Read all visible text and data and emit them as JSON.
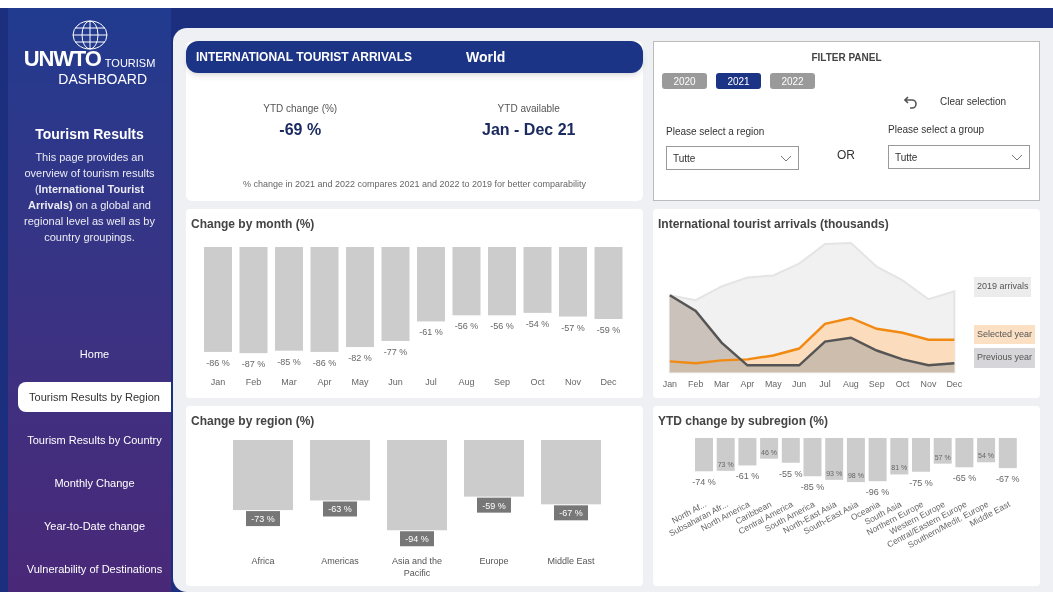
{
  "sidebar": {
    "logo_text": "UNWTO",
    "logo_sub1": "TOURISM",
    "logo_sub2": "DASHBOARD",
    "title": "Tourism Results",
    "description": "This page provides an overview of tourism results (**International Tourist Arrivals)** on a global and regional level as well as by country groupings.",
    "nav": [
      {
        "label": "Home",
        "selected": false
      },
      {
        "label": "Tourism Results by Region",
        "selected": true
      },
      {
        "label": "Tourism Results by Country",
        "selected": false
      },
      {
        "label": "Monthly Change",
        "selected": false
      },
      {
        "label": "Year-to-Date change",
        "selected": false
      },
      {
        "label": "Vulnerability of Destinations",
        "selected": false
      }
    ]
  },
  "summary": {
    "header": "INTERNATIONAL TOURIST ARRIVALS",
    "area": "World",
    "kpis": [
      {
        "label": "YTD change (%)",
        "value": "-69 %"
      },
      {
        "label": "YTD available",
        "value": "Jan - Dec 21"
      }
    ],
    "note": "% change in 2021 and 2022 compares 2021 and 2022  to 2019 for better comparability"
  },
  "filter_panel": {
    "title": "FILTER PANEL",
    "years": [
      {
        "label": "2020",
        "selected": false
      },
      {
        "label": "2021",
        "selected": true
      },
      {
        "label": "2022",
        "selected": false
      }
    ],
    "clear": "Clear selection",
    "region_label": "Please select a region",
    "region_value": "Tutte",
    "or": "OR",
    "group_label": "Please select a group",
    "group_value": "Tutte"
  },
  "month_chart": {
    "chart_data": {
      "type": "bar",
      "title": "Change by month (%)",
      "categories": [
        "Jan",
        "Feb",
        "Mar",
        "Apr",
        "May",
        "Jun",
        "Jul",
        "Aug",
        "Sep",
        "Oct",
        "Nov",
        "Dec"
      ],
      "values": [
        -86,
        -87,
        -85,
        -86,
        -82,
        -77,
        -61,
        -56,
        -56,
        -54,
        -57,
        -59
      ],
      "value_labels": [
        "-86 %",
        "-87 %",
        "-85 %",
        "-86 %",
        "-82 %",
        "-77 %",
        "-61 %",
        "-56 %",
        "-56 %",
        "-54 %",
        "-57 %",
        "-59 %"
      ]
    }
  },
  "arrivals_chart": {
    "title": "International tourist arrivals (thousands)",
    "x_labels": [
      "Jan",
      "Feb",
      "Mar",
      "Apr",
      "May",
      "Jun",
      "Jul",
      "Aug",
      "Sep",
      "Oct",
      "Nov",
      "Dec"
    ],
    "legend": [
      {
        "label": "2019 arrivals",
        "color": "#ececec"
      },
      {
        "label": "Selected year",
        "color": "#fbe0c4"
      },
      {
        "label": "Previous year",
        "color": "#d6d6da"
      }
    ]
  },
  "region_chart": {
    "chart_data": {
      "type": "bar",
      "title": "Change by region (%)",
      "categories": [
        "Africa",
        "Americas",
        "Asia and the Pacific",
        "Europe",
        "Middle East"
      ],
      "values": [
        -73,
        -63,
        -94,
        -59,
        -67
      ],
      "value_labels": [
        "-73 %",
        "-63 %",
        "-94 %",
        "-59 %",
        "-67 %"
      ]
    }
  },
  "subregion_chart": {
    "chart_data": {
      "type": "bar",
      "title": "YTD change by subregion (%)",
      "categories": [
        "North Af...",
        "Subsaharan Afr...",
        "North America",
        "Caribbean",
        "Central America",
        "South America",
        "North-East Asia",
        "South-East Asia",
        "Oceania",
        "South Asia",
        "Northern Europe",
        "Western Europe",
        "Central/Eastern Europe",
        "Southern/Medit. Europe",
        "Middle East"
      ],
      "values": [
        -74,
        -73,
        -61,
        -46,
        -55,
        -85,
        -93,
        -98,
        -96,
        -81,
        -75,
        -57,
        -65,
        -54,
        -67
      ],
      "value_labels": [
        "-74 %",
        null,
        "-61 %",
        null,
        "-55 %",
        "-85 %",
        null,
        null,
        "-96 %",
        null,
        "-75 %",
        null,
        "-65 %",
        null,
        "-67 %"
      ],
      "annotations": [
        "73 %",
        "46 %",
        "93 %",
        "98 %",
        "81 %",
        "57 %",
        "54 %"
      ]
    }
  }
}
